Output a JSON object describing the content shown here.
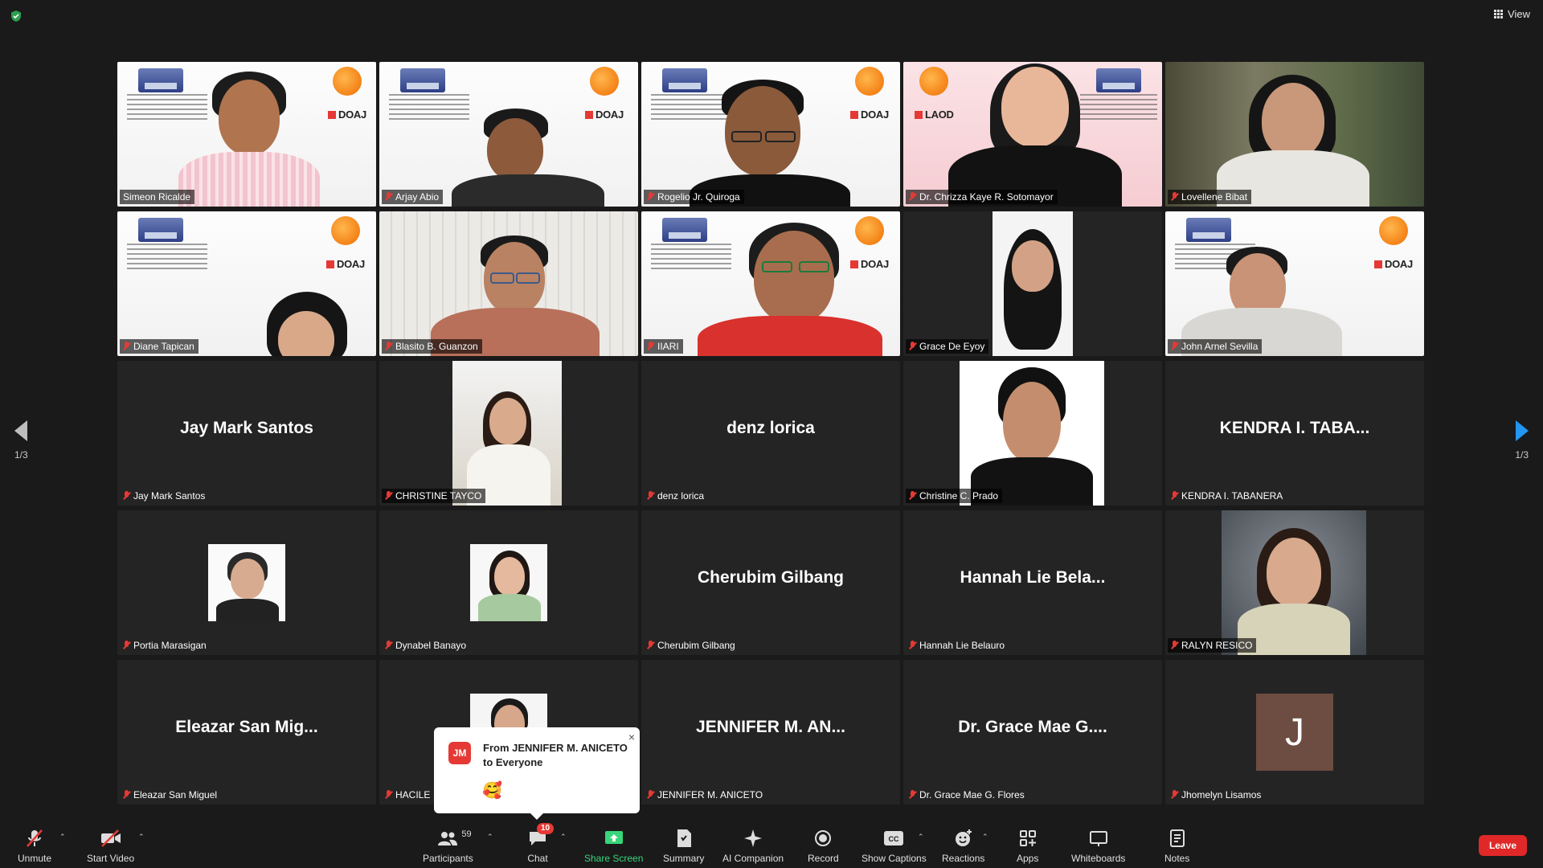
{
  "view_button": {
    "label": "View"
  },
  "pagination": {
    "left_label": "1/3",
    "right_label": "1/3"
  },
  "tiles": [
    {
      "name": "Simeon Ricalde"
    },
    {
      "name": "Arjay Abio"
    },
    {
      "name": "Rogelio Jr. Quiroga"
    },
    {
      "name": "Dr. Chrizza Kaye R. Sotomayor"
    },
    {
      "name": "Lovellene Bibat"
    },
    {
      "name": "Diane Tapican"
    },
    {
      "name": "Blasito B. Guanzon"
    },
    {
      "name": "IIARI"
    },
    {
      "name": "Grace De Eyoy"
    },
    {
      "name": "John Arnel Sevilla"
    },
    {
      "name": "Jay Mark Santos",
      "display": "Jay Mark Santos"
    },
    {
      "name": "CHRISTINE TAYCO"
    },
    {
      "name": "denz lorica",
      "display": "denz lorica"
    },
    {
      "name": "Christine C. Prado"
    },
    {
      "name": "KENDRA I. TABANERA",
      "display": "KENDRA I. TABA..."
    },
    {
      "name": "Portia Marasigan"
    },
    {
      "name": "Dynabel Banayo"
    },
    {
      "name": "Cherubim Gilbang",
      "display": "Cherubim Gilbang"
    },
    {
      "name": "Hannah Lie Belauro",
      "display": "Hannah Lie Bela..."
    },
    {
      "name": "RALYN RESICO"
    },
    {
      "name": "Eleazar San Miguel",
      "display": "Eleazar San Mig..."
    },
    {
      "name": "HACILE"
    },
    {
      "name": "JENNIFER M. ANICETO",
      "display": "JENNIFER M. AN..."
    },
    {
      "name": "Dr. Grace Mae G. Flores",
      "display": "Dr. Grace Mae G...."
    },
    {
      "name": "Jhomelyn Lisamos",
      "avatar_letter": "J"
    }
  ],
  "slide": {
    "doaj": "DOAJ",
    "doaj_mirrored": "LAOD"
  },
  "chat_popup": {
    "avatar_initials": "JM",
    "title": "From JENNIFER M. ANICETO to Everyone",
    "emoji": "🥰",
    "close": "×"
  },
  "toolbar": {
    "unmute": "Unmute",
    "start_video": "Start Video",
    "participants": "Participants",
    "participants_count": "59",
    "chat": "Chat",
    "chat_badge": "10",
    "share_screen": "Share Screen",
    "summary": "Summary",
    "ai_companion": "AI Companion",
    "record": "Record",
    "show_captions": "Show Captions",
    "cc_icon_text": "CC",
    "reactions": "Reactions",
    "apps": "Apps",
    "whiteboards": "Whiteboards",
    "notes": "Notes",
    "leave": "Leave",
    "caret": "⌃"
  },
  "colors": {
    "active_speaker": "#d4e157",
    "share_green": "#37d67a",
    "leave_red": "#e02828",
    "next_page_blue": "#2196f3"
  }
}
